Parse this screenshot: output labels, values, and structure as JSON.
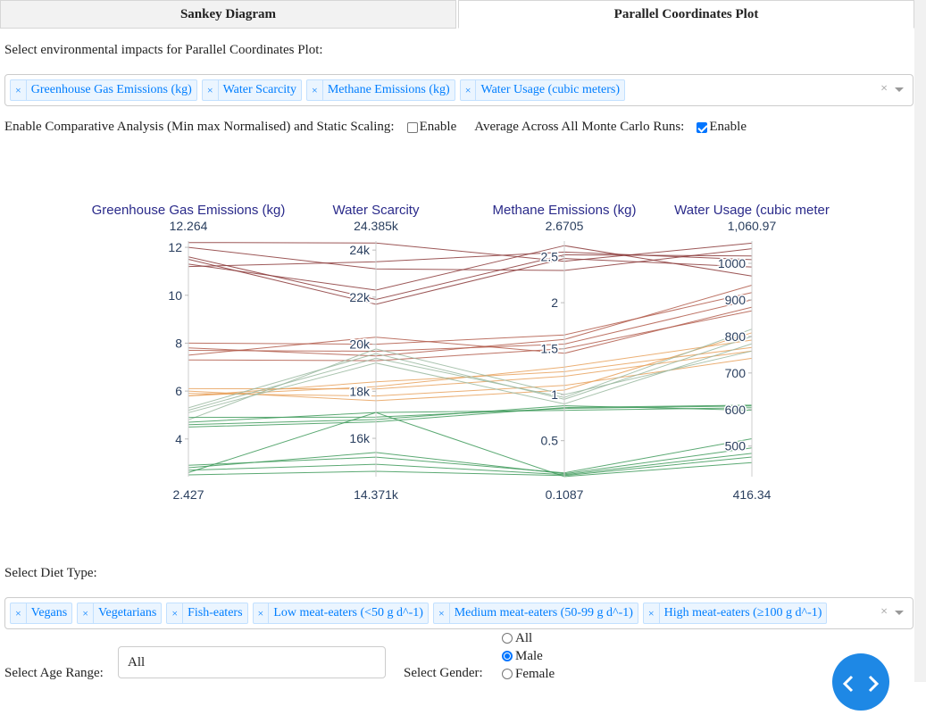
{
  "tabs": [
    {
      "label": "Sankey Diagram",
      "active": false
    },
    {
      "label": "Parallel Coordinates Plot",
      "active": true
    }
  ],
  "impacts_label": "Select environmental impacts for Parallel Coordinates Plot:",
  "impacts": [
    "Greenhouse Gas Emissions (kg)",
    "Water Scarcity",
    "Methane Emissions (kg)",
    "Water Usage (cubic meters)"
  ],
  "options": {
    "comparative_label": "Enable Comparative Analysis (Min max Normalised) and Static Scaling:",
    "comparative_enable": "Enable",
    "comparative_checked": false,
    "average_label": "Average Across All Monte Carlo Runs:",
    "average_enable": "Enable",
    "average_checked": true
  },
  "chart_data": {
    "type": "parallel_coordinates",
    "axes": [
      {
        "label": "Greenhouse Gas Emissions (kg)",
        "max_label": "12.264",
        "min_label": "2.427",
        "min": 2.427,
        "max": 12.264,
        "ticks": [
          {
            "v": 4,
            "t": "4"
          },
          {
            "v": 6,
            "t": "6"
          },
          {
            "v": 8,
            "t": "8"
          },
          {
            "v": 10,
            "t": "10"
          },
          {
            "v": 12,
            "t": "12"
          }
        ]
      },
      {
        "label": "Water Scarcity",
        "max_label": "24.385k",
        "min_label": "14.371k",
        "min": 14371,
        "max": 24385,
        "ticks": [
          {
            "v": 16000,
            "t": "16k"
          },
          {
            "v": 18000,
            "t": "18k"
          },
          {
            "v": 20000,
            "t": "20k"
          },
          {
            "v": 22000,
            "t": "22k"
          },
          {
            "v": 24000,
            "t": "24k"
          }
        ]
      },
      {
        "label": "Methane Emissions (kg)",
        "max_label": "2.6705",
        "min_label": "0.1087",
        "min": 0.1087,
        "max": 2.6705,
        "ticks": [
          {
            "v": 0.5,
            "t": "0.5"
          },
          {
            "v": 1,
            "t": "1"
          },
          {
            "v": 1.5,
            "t": "1.5"
          },
          {
            "v": 2,
            "t": "2"
          },
          {
            "v": 2.5,
            "t": "2.5"
          }
        ]
      },
      {
        "label": "Water Usage (cubic meter",
        "max_label": "1,060.97",
        "min_label": "416.34",
        "min": 416.34,
        "max": 1060.97,
        "ticks": [
          {
            "v": 500,
            "t": "500"
          },
          {
            "v": 600,
            "t": "600"
          },
          {
            "v": 700,
            "t": "700"
          },
          {
            "v": 800,
            "t": "800"
          },
          {
            "v": 900,
            "t": "900"
          },
          {
            "v": 1000,
            "t": "1000"
          }
        ]
      }
    ],
    "colors": {
      "high_meat": "#8b3a3a",
      "medium_meat": "#b15a4a",
      "vegetarian": "#e8a15c",
      "fish": "#9ab8a0",
      "vegan": "#3e9a5a"
    },
    "lines": [
      {
        "group": "high_meat",
        "values": [
          12.2,
          24300,
          2.45,
          1055
        ]
      },
      {
        "group": "high_meat",
        "values": [
          11.6,
          21900,
          2.52,
          1020
        ]
      },
      {
        "group": "high_meat",
        "values": [
          11.5,
          21700,
          2.48,
          990
        ]
      },
      {
        "group": "high_meat",
        "values": [
          11.3,
          22300,
          2.62,
          965
        ]
      },
      {
        "group": "high_meat",
        "values": [
          11.2,
          23500,
          2.55,
          1010
        ]
      },
      {
        "group": "high_meat",
        "values": [
          12.0,
          23200,
          2.35,
          1040
        ]
      },
      {
        "group": "medium_meat",
        "values": [
          8.0,
          20000,
          1.65,
          920
        ]
      },
      {
        "group": "medium_meat",
        "values": [
          7.7,
          19700,
          1.55,
          900
        ]
      },
      {
        "group": "medium_meat",
        "values": [
          7.5,
          20300,
          1.45,
          880
        ]
      },
      {
        "group": "medium_meat",
        "values": [
          7.8,
          19500,
          1.6,
          940
        ]
      },
      {
        "group": "medium_meat",
        "values": [
          7.3,
          19300,
          1.5,
          870
        ]
      },
      {
        "group": "vegetarian",
        "values": [
          6.1,
          18100,
          1.2,
          760
        ]
      },
      {
        "group": "vegetarian",
        "values": [
          5.9,
          17800,
          1.1,
          740
        ]
      },
      {
        "group": "vegetarian",
        "values": [
          5.8,
          18200,
          1.3,
          790
        ]
      },
      {
        "group": "vegetarian",
        "values": [
          6.0,
          17600,
          1.05,
          810
        ]
      },
      {
        "group": "vegetarian",
        "values": [
          5.8,
          18400,
          1.25,
          770
        ]
      },
      {
        "group": "fish",
        "values": [
          5.3,
          19600,
          0.95,
          800
        ]
      },
      {
        "group": "fish",
        "values": [
          5.1,
          19200,
          0.9,
          780
        ]
      },
      {
        "group": "fish",
        "values": [
          4.8,
          19800,
          1.0,
          760
        ]
      },
      {
        "group": "fish",
        "values": [
          5.2,
          19400,
          0.97,
          820
        ]
      },
      {
        "group": "vegan",
        "values": [
          4.9,
          16900,
          0.85,
          610
        ]
      },
      {
        "group": "vegan",
        "values": [
          4.7,
          17100,
          0.83,
          605
        ]
      },
      {
        "group": "vegan",
        "values": [
          4.6,
          16800,
          0.88,
          598
        ]
      },
      {
        "group": "vegan",
        "values": [
          4.5,
          16700,
          0.86,
          612
        ]
      },
      {
        "group": "vegan",
        "values": [
          2.9,
          15200,
          0.15,
          520
        ]
      },
      {
        "group": "vegan",
        "values": [
          2.7,
          14900,
          0.13,
          480
        ]
      },
      {
        "group": "vegan",
        "values": [
          2.5,
          14600,
          0.12,
          470
        ]
      },
      {
        "group": "vegan",
        "values": [
          2.6,
          17100,
          0.11,
          455
        ]
      },
      {
        "group": "vegan",
        "values": [
          2.8,
          15400,
          0.14,
          495
        ]
      }
    ]
  },
  "diet_label": "Select Diet Type:",
  "diets": [
    "Vegans",
    "Vegetarians",
    "Fish-eaters",
    "Low meat-eaters (<50 g d^-1)",
    "Medium meat-eaters (50-99 g d^-1)",
    "High meat-eaters (≥100 g d^-1)"
  ],
  "age": {
    "label": "Select Age Range:",
    "value": "All"
  },
  "gender": {
    "label": "Select Gender:",
    "options": [
      "All",
      "Male",
      "Female"
    ],
    "selected": "Male"
  },
  "clear_symbol": "×"
}
